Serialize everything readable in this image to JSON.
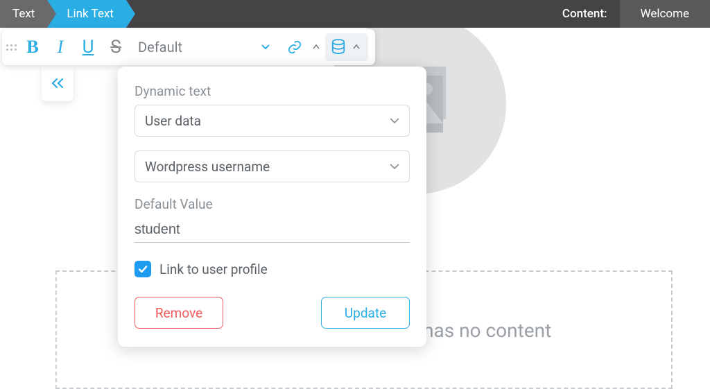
{
  "breadcrumb": {
    "first": "Text",
    "second": "Link Text"
  },
  "header": {
    "content_label": "Content:",
    "welcome": "Welcome"
  },
  "toolbar": {
    "font": "Default"
  },
  "popover": {
    "dynamic_label": "Dynamic text",
    "source_value": "User data",
    "field_value": "Wordpress username",
    "default_label": "Default Value",
    "default_value": "student",
    "link_profile_label": "Link to user profile",
    "remove": "Remove",
    "update": "Update"
  },
  "background": {
    "lesson_empty": "The lesson you are previewing has no content"
  }
}
